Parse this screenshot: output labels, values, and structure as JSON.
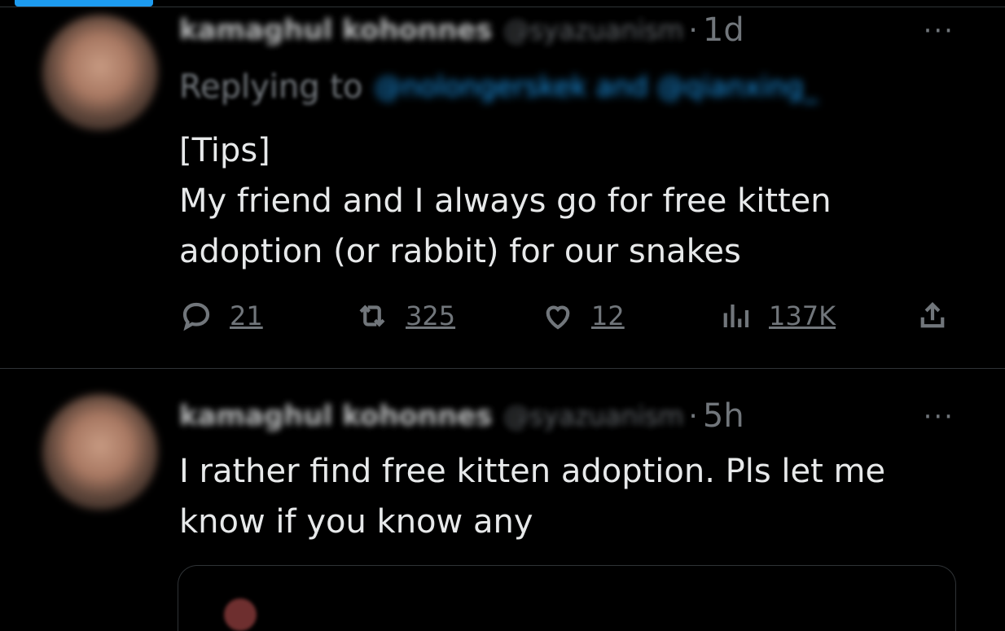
{
  "tweets": [
    {
      "author_name": "kamaghul kohonnes",
      "author_handle": "@syazuanism",
      "time": "1d",
      "reply_prefix": "Replying to",
      "reply_mentions": "@nolongerskek and @qianxing_",
      "text": "[Tips]\nMy friend and I always go for free kitten\nadoption (or rabbit) for our snakes",
      "actions": {
        "replies": "21",
        "retweets": "325",
        "likes": "12",
        "views": "137K"
      },
      "more_label": "···"
    },
    {
      "author_name": "kamaghul kohonnes",
      "author_handle": "@syazuanism",
      "time": "5h",
      "text": "I rather find free kitten adoption. Pls let me\nknow if you know any",
      "more_label": "···"
    }
  ],
  "icons": {
    "reply": "reply-icon",
    "retweet": "retweet-icon",
    "like": "heart-icon",
    "views": "views-icon",
    "share": "share-icon"
  },
  "colors": {
    "background": "#000000",
    "text": "#e7e9ea",
    "muted": "#71767b",
    "accent": "#1d9bf0",
    "divider": "#2f3336"
  }
}
